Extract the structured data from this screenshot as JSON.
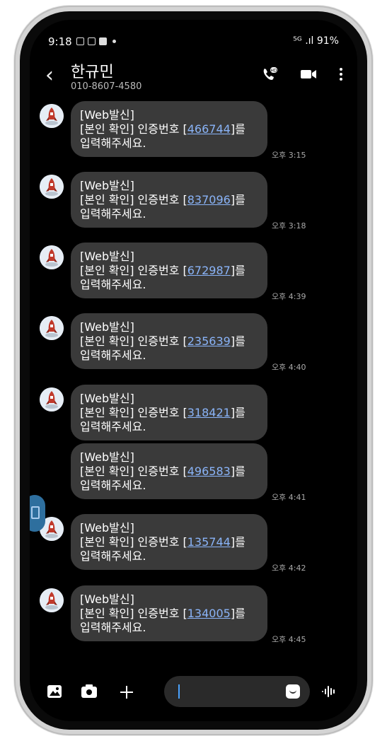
{
  "status_bar": {
    "time": "9:18",
    "right": "⁵ᴳ .ıl 91%"
  },
  "header": {
    "back_icon": "chevron-left-icon",
    "name": "한규민",
    "phone": "010-8607-4580"
  },
  "messages": [
    {
      "line1": "[Web발신]",
      "line2_prefix": "[본인 확인] 인증번호 [",
      "code": "466744",
      "line2_suffix": "]를",
      "line3": "입력해주세요.",
      "time": "오후 3:15",
      "has_avatar": true
    },
    {
      "line1": "[Web발신]",
      "line2_prefix": "[본인 확인] 인증번호 [",
      "code": "837096",
      "line2_suffix": "]를",
      "line3": "입력해주세요.",
      "time": "오후 3:18",
      "has_avatar": true
    },
    {
      "line1": "[Web발신]",
      "line2_prefix": "[본인 확인] 인증번호 [",
      "code": "672987",
      "line2_suffix": "]를",
      "line3": "입력해주세요.",
      "time": "오후 4:39",
      "has_avatar": true
    },
    {
      "line1": "[Web발신]",
      "line2_prefix": "[본인 확인] 인증번호 [",
      "code": "235639",
      "line2_suffix": "]를",
      "line3": "입력해주세요.",
      "time": "오후 4:40",
      "has_avatar": true
    },
    {
      "line1": "[Web발신]",
      "line2_prefix": "[본인 확인] 인증번호 [",
      "code": "318421",
      "line2_suffix": "]를",
      "line3": "입력해주세요.",
      "time": "",
      "has_avatar": true
    },
    {
      "line1": "[Web발신]",
      "line2_prefix": "[본인 확인] 인증번호 [",
      "code": "496583",
      "line2_suffix": "]를",
      "line3": "입력해주세요.",
      "time": "오후 4:41",
      "has_avatar": false
    },
    {
      "line1": "[Web발신]",
      "line2_prefix": "[본인 확인] 인증번호 [",
      "code": "135744",
      "line2_suffix": "]를",
      "line3": "입력해주세요.",
      "time": "오후 4:42",
      "has_avatar": true
    },
    {
      "line1": "[Web발신]",
      "line2_prefix": "[본인 확인] 인증번호 [",
      "code": "134005",
      "line2_suffix": "]를",
      "line3": "입력해주세요.",
      "time": "오후 4:45",
      "has_avatar": true
    }
  ],
  "composer": {
    "gallery_icon": "gallery-icon",
    "camera_icon": "camera-icon",
    "add_icon": "plus-icon",
    "sticker_icon": "sticker-icon",
    "voice_icon": "voice-wave-icon"
  },
  "colors": {
    "bubble": "#3a3a3a",
    "link": "#8ab4f8",
    "background": "#000000"
  }
}
